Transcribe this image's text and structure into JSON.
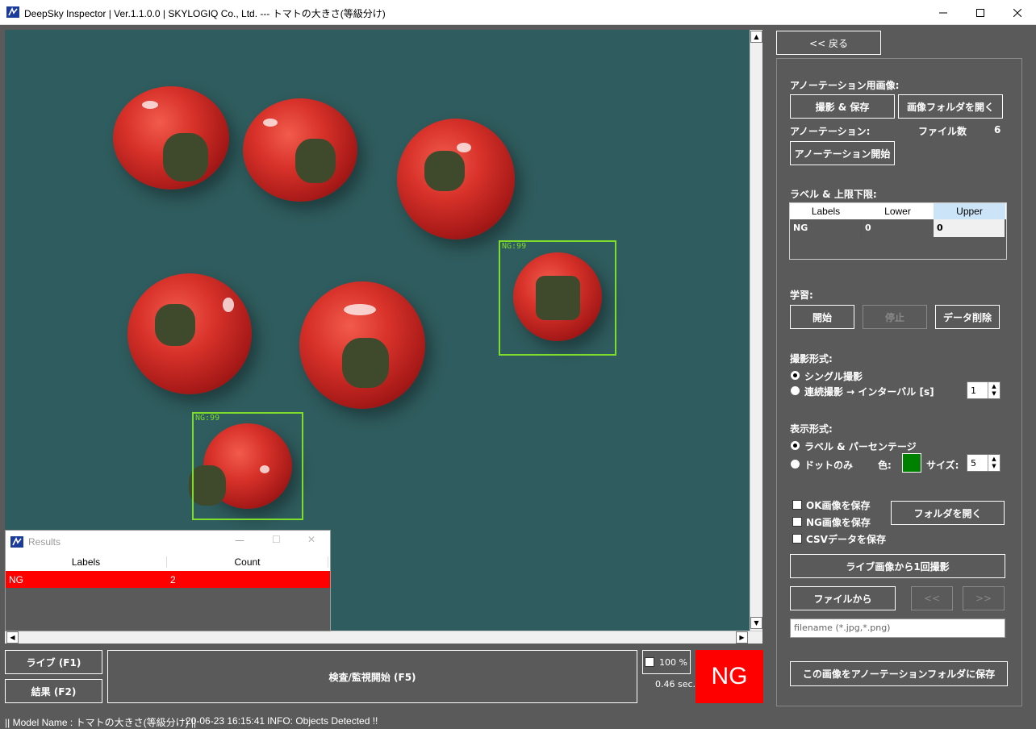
{
  "window": {
    "title": "DeepSky Inspector | Ver.1.1.0.0 | SKYLOGIQ Co., Ltd. --- トマトの大きさ(等級分け)"
  },
  "detections": [
    {
      "label": "NG:99"
    },
    {
      "label": "NG:99"
    }
  ],
  "results": {
    "title": "Results",
    "columns": [
      "Labels",
      "Count"
    ],
    "rows": [
      {
        "label": "NG",
        "count": "2"
      }
    ]
  },
  "bottom": {
    "live_btn": "ライブ (F1)",
    "result_btn": "結果 (F2)",
    "inspect_btn": "検査/監視開始 (F5)",
    "zoom": "100 %",
    "time": "0.46 sec.",
    "verdict": "NG",
    "verdict_color": "#ff0000"
  },
  "panel": {
    "back_btn": "<< 戻る",
    "anno_images_label": "アノーテーション用画像:",
    "capture_save_btn": "撮影 & 保存",
    "open_image_folder_btn": "画像フォルダを開く",
    "anno_label": "アノーテーション:",
    "file_count_label": "ファイル数",
    "file_count": "6",
    "anno_start_btn": "アノーテーション開始",
    "limits_label": "ラベル & 上限下限:",
    "limits_columns": [
      "Labels",
      "Lower",
      "Upper"
    ],
    "limits_row": {
      "label": "NG",
      "lower": "0",
      "upper": "0"
    },
    "learn_label": "学習:",
    "start_btn": "開始",
    "stop_btn": "停止",
    "delete_data_btn": "データ削除",
    "capture_mode_label": "撮影形式:",
    "single_capture": "シングル撮影",
    "interval_capture": "連続撮影 → インターバル [s]",
    "interval_value": "1",
    "display_mode_label": "表示形式:",
    "label_percent": "ラベル & パーセンテージ",
    "dot_only": "ドットのみ",
    "color_label": "色:",
    "dot_color": "#008000",
    "size_label": "サイズ:",
    "size_value": "5",
    "save_ok": "OK画像を保存",
    "save_ng": "NG画像を保存",
    "save_csv": "CSVデータを保存",
    "open_folder_btn": "フォルダを開く",
    "capture_once_btn": "ライブ画像から1回撮影",
    "from_file_btn": "ファイルから",
    "prev_btn": "<<",
    "next_btn": ">>",
    "filename_placeholder": "filename (*.jpg,*.png)",
    "save_to_anno_btn": "この画像をアノーテーションフォルダに保存"
  },
  "status": {
    "model_name": "|| Model Name : トマトの大きさ(等級分け) ||",
    "timestamp": "20-06-23 16:15:41",
    "info": "INFO:   Objects Detected !!"
  }
}
